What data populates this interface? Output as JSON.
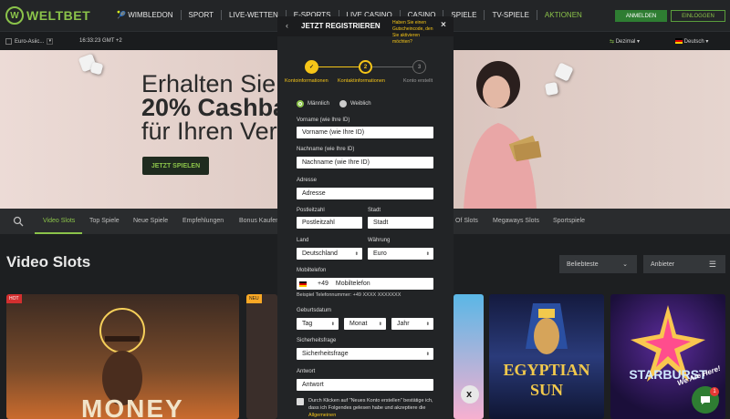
{
  "brand": {
    "name": "WELTBET",
    "color": "#8bc34a"
  },
  "nav": {
    "items": [
      {
        "label": "WIMBLEDON",
        "active": false
      },
      {
        "label": "SPORT",
        "active": false
      },
      {
        "label": "LIVE-WETTEN",
        "active": false
      },
      {
        "label": "E-SPORTS",
        "active": false
      },
      {
        "label": "LIVE CASINO",
        "active": false
      },
      {
        "label": "CASINO",
        "active": false
      },
      {
        "label": "SPIELE",
        "active": false
      },
      {
        "label": "TV-SPIELE",
        "active": false
      },
      {
        "label": "AKTIONEN",
        "active": true
      }
    ],
    "login_label": "ANMELDEN",
    "register_label": "EINLOGGEN"
  },
  "subbar": {
    "region": "Euro-Asiic...",
    "time": "16:33:23 GMT +2",
    "odds_format": "Dezimal",
    "language": "Deutsch"
  },
  "banner": {
    "line1": "Erhalten Sie",
    "line2": "20% Cashba",
    "line3": "für Ihren Ver",
    "button": "JETZT SPIELEN"
  },
  "categories": {
    "items": [
      "Video Slots",
      "Top Spiele",
      "Neue Spiele",
      "Empfehlungen",
      "Bonus Kaufen",
      "Of Slots",
      "Megaways Slots",
      "Sportspiele"
    ],
    "active": "Video Slots"
  },
  "section": {
    "title": "Video Slots",
    "sort_label": "Beliebteste",
    "provider_label": "Anbieter"
  },
  "tiles": [
    {
      "tag": "HOT",
      "tag_color": "#d32f2f",
      "title": "MONEY"
    },
    {
      "tag": "NEU",
      "tag_color": "#f9a825",
      "title": ""
    },
    {
      "tag": "",
      "tag_color": "",
      "title": ""
    },
    {
      "tag": "",
      "tag_color": "",
      "title": "EGYPTIAN SUN"
    },
    {
      "tag": "",
      "tag_color": "",
      "title": "STARBURST"
    }
  ],
  "modal": {
    "title": "JETZT REGISTRIEREN",
    "promo_text": "Haben Sie einen Gutscheincode, den Sie aktivieren möchten?",
    "steps": [
      {
        "number": "1",
        "label": "Kontoinformationen"
      },
      {
        "number": "2",
        "label": "Kontaktinformationen"
      },
      {
        "number": "3",
        "label": "Konto erstellt"
      }
    ],
    "gender": {
      "male": "Männlich",
      "female": "Weiblich"
    },
    "firstname": {
      "label": "Vorname (wie Ihre ID)",
      "placeholder": "Vorname (wie Ihre ID)"
    },
    "lastname": {
      "label": "Nachname (wie Ihre ID)",
      "placeholder": "Nachname (wie Ihre ID)"
    },
    "address": {
      "label": "Adresse",
      "placeholder": "Adresse"
    },
    "postcode": {
      "label": "Postleitzahl",
      "placeholder": "Postleitzahl"
    },
    "city": {
      "label": "Stadt",
      "placeholder": "Stadt"
    },
    "country": {
      "label": "Land",
      "value": "Deutschland"
    },
    "currency": {
      "label": "Währung",
      "value": "Euro"
    },
    "phone": {
      "label": "Mobiltelefon",
      "prefix": "+49",
      "placeholder": "Mobiltelefon",
      "example": "Beispiel Telefonnummer: +49 XXXX XXXXXXX"
    },
    "birthdate": {
      "label": "Geburtsdatum",
      "day": "Tag",
      "month": "Monat",
      "year": "Jahr"
    },
    "security_question": {
      "label": "Sicherheitsfrage",
      "value": "Sicherheitsfrage"
    },
    "answer": {
      "label": "Antwort",
      "placeholder": "Antwort"
    },
    "terms": {
      "text": "Durch Klicken auf \"Neues Konto erstellen\" bestätige ich, dass ich Folgendes gelesen habe und akzeptiere die ",
      "link": "Allgemeinen"
    }
  },
  "chat": {
    "label": "We Are Here!",
    "badge": "1"
  }
}
